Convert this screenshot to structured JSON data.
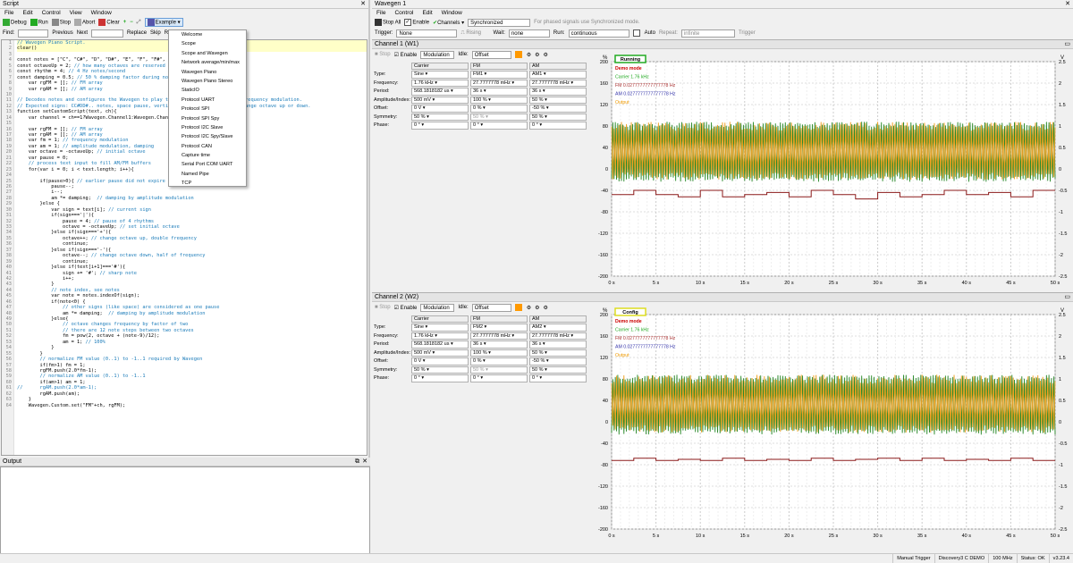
{
  "script": {
    "title": "Script",
    "menu": [
      "File",
      "Edit",
      "Control",
      "View",
      "Window"
    ],
    "toolbar": [
      "Debug",
      "Run",
      "Stop",
      "Abort",
      "Clear",
      "Example"
    ],
    "find": {
      "label": "Find:",
      "previous": "Previous",
      "next": "Next",
      "replace": "Replace",
      "skip": "Skip",
      "repl": "Repl"
    },
    "lines": [
      "// Wavegen Piano Script.",
      "clear()",
      "",
      "const notes = [\"C\", \"C#\", \"D\", \"D#\", \"E\", \"F\", \"F#\", \"G\", \"G#\", \"A\", \"A#\", \"B\"];",
      "const octaveUp = 2; // how many octaves are reserved",
      "const rhythm = 4; // 4 Hz notes/second",
      "const damping = 0.5; // 50 % damping factor during note",
      "    var rgFM = []; // FM array",
      "    var rgAM = []; // AM array",
      "",
      "// Decodes notes and configures the Wavegen to play the melody using amplitude/frequency modulation.",
      "// Expected signs: CC#DD#.. notes, space pause, vertical line for major/minor change octave up or down.",
      "function setCustomScript(text, ch){",
      "    var channel = ch==1?Wavegen.Channel1:Wavegen.Channel2;",
      "",
      "    var rgFM = []; // FM array",
      "    var rgAM = []; // AM array",
      "    var fm = 1; // frequency modulation",
      "    var am = 1; // amplitude modulation, damping",
      "    var octave = -octaveUp; // initial octave",
      "    var pause = 0;",
      "    // process text input to fill AM/FM buffers",
      "    for(var i = 0; i < text.length; i++){",
      "",
      "        if(pause>0){ // earlier pause did not expire",
      "            pause--;",
      "            i--;",
      "            am *= damping;  // damping by amplitude modulation",
      "        }else {",
      "            var sign = text[i]; // current sign",
      "            if(sign==='|'){",
      "                pause = 4; // pause of 4 rhythms",
      "                octave = -octaveUp; // set initial octave",
      "            }else if(sign==='+'){",
      "                octave++; // change octave up, double frequency",
      "                continue;",
      "            }else if(sign==='-'){",
      "                octave--; // change octave down, half of frequency",
      "                continue;",
      "            }else if(text[i+1]==='#'){",
      "                sign += '#'; // sharp note",
      "                i++;",
      "            }",
      "            // note index, see notes",
      "            var note = notes.indexOf(sign);",
      "            if(note<0) {",
      "                // other signs (like space) are considered as one pause",
      "                am *= damping;  // damping by amplitude modulation",
      "            }else{",
      "                // octave changes frequency by factor of two",
      "                // there are 12 note steps between two octaves",
      "                fm = pow(2, octave + (note-9)/12);",
      "                am = 1; // 100%",
      "            }",
      "        }",
      "        // normalize FM value (0..1) to -1..1 required by Wavegen",
      "        if(fm>1) fm = 1;",
      "        rgFM.push(2.0*fm-1);",
      "        // normalize AM value (0..1) to -1..1",
      "        if(am>1) am = 1;",
      "//      rgAM.push(2.0*am-1);",
      "        rgAM.push(am);",
      "    }",
      "    Wavegen.Custom.set(\"FM\"+ch, rgFM);"
    ],
    "examples": [
      "Welcome",
      "Scope",
      "Scope and Wavegen",
      "Network average/min/max",
      "Wavegen Piano",
      "Wavegen Piano Stereo",
      "StaticIO",
      "Protocol UART",
      "Protocol SPI",
      "Protocol SPI Spy",
      "Protocol I2C Slave",
      "Protocol I2C Spy/Slave",
      "Protocol CAN",
      "Capture time",
      "Serial Port COM UART",
      "Named Pipe",
      "TCP"
    ],
    "output": "Output"
  },
  "wavegen": {
    "title": "Wavegen 1",
    "menu": [
      "File",
      "Control",
      "Edit",
      "Window"
    ],
    "toolbar": {
      "stop_all": "Stop All",
      "enable": "Enable",
      "channels": "Channels",
      "sync": "Synchronized",
      "sync_note": "For phased signals use Synchronized mode."
    },
    "trigger": {
      "label": "Trigger:",
      "value": "None",
      "wait_label": "Wait:",
      "wait": "none",
      "run_label": "Run:",
      "run": "continuous",
      "auto": "Auto",
      "repeat_label": "Repeat:",
      "repeat": "infinite",
      "trigger_btn": "Trigger"
    },
    "channels": [
      {
        "name": "Channel 1 (W1)",
        "stop": "Stop",
        "enable": "Enable",
        "mod": "Modulation",
        "idle": "Idle:",
        "idle_val": "Offset",
        "status": "Running",
        "status_color": "#22aa22",
        "heads": [
          "Carrier",
          "FM",
          "AM"
        ],
        "types": [
          "Sine",
          "FM1",
          "AM1"
        ],
        "rows": [
          [
            "Type:",
            "Sine",
            "FM1",
            "AM1"
          ],
          [
            "Frequency:",
            "1.76 kHz",
            "27.7777778 mHz",
            "27.7777778 mHz"
          ],
          [
            "Period:",
            "568.1818182 us",
            "36 s",
            "36 s"
          ],
          [
            "Amplitude/Index:",
            "500 mV",
            "100 %",
            "50 %"
          ],
          [
            "Offset:",
            "0 V",
            "0 %",
            "-50 %"
          ],
          [
            "Symmetry:",
            "50 %",
            "50 %",
            "50 %"
          ],
          [
            "Phase:",
            "0 °",
            "0 °",
            "0 °"
          ]
        ],
        "legend": [
          "Demo mode",
          "Carrier 1.76 kHz",
          "FM 0.0277777777777778 Hz",
          "AM 0.0277777777777778 Hz",
          "Output"
        ],
        "yleft": [
          "200",
          "160",
          "120",
          "80",
          "40",
          "0",
          "-40",
          "-80",
          "-120",
          "-160",
          "-200"
        ],
        "yright": [
          "2.5",
          "2",
          "1.5",
          "1",
          "0.5",
          "0",
          "-0.5",
          "-1",
          "-1.5",
          "-2",
          "-2.5"
        ],
        "x": [
          "0 s",
          "5 s",
          "10 s",
          "15 s",
          "20 s",
          "25 s",
          "30 s",
          "35 s",
          "40 s",
          "45 s",
          "50 s"
        ]
      },
      {
        "name": "Channel 2 (W2)",
        "stop": "Stop",
        "enable": "Enable",
        "mod": "Modulation",
        "idle": "Idle:",
        "idle_val": "Offset",
        "status": "Config",
        "status_color": "#dddd22",
        "heads": [
          "Carrier",
          "FM",
          "AM"
        ],
        "types": [
          "Sine",
          "FM2",
          "AM2"
        ],
        "rows": [
          [
            "Type:",
            "Sine",
            "FM2",
            "AM2"
          ],
          [
            "Frequency:",
            "1.76 kHz",
            "27.7777778 mHz",
            "27.7777778 mHz"
          ],
          [
            "Period:",
            "568.1818182 us",
            "36 s",
            "36 s"
          ],
          [
            "Amplitude/Index:",
            "500 mV",
            "100 %",
            "50 %"
          ],
          [
            "Offset:",
            "0 V",
            "0 %",
            "-50 %"
          ],
          [
            "Symmetry:",
            "50 %",
            "50 %",
            "50 %"
          ],
          [
            "Phase:",
            "0 °",
            "0 °",
            "0 °"
          ]
        ],
        "legend": [
          "Demo mode",
          "Carrier 1.76 kHz",
          "FM 0.0277777777777778 Hz",
          "AM 0.0277777777777778 Hz",
          "Output"
        ],
        "yleft": [
          "200",
          "160",
          "120",
          "80",
          "40",
          "0",
          "-40",
          "-80",
          "-120",
          "-160",
          "-200"
        ],
        "yright": [
          "2.5",
          "2",
          "1.5",
          "1",
          "0.5",
          "0",
          "-0.5",
          "-1",
          "-1.5",
          "-2",
          "-2.5"
        ],
        "x": [
          "0 s",
          "5 s",
          "10 s",
          "15 s",
          "20 s",
          "25 s",
          "30 s",
          "35 s",
          "40 s",
          "45 s",
          "50 s"
        ]
      }
    ]
  },
  "statusbar": [
    "Manual Trigger",
    "Discovery3 C DEMO",
    "100 MHz",
    "Status: OK",
    "v3.23.4"
  ]
}
